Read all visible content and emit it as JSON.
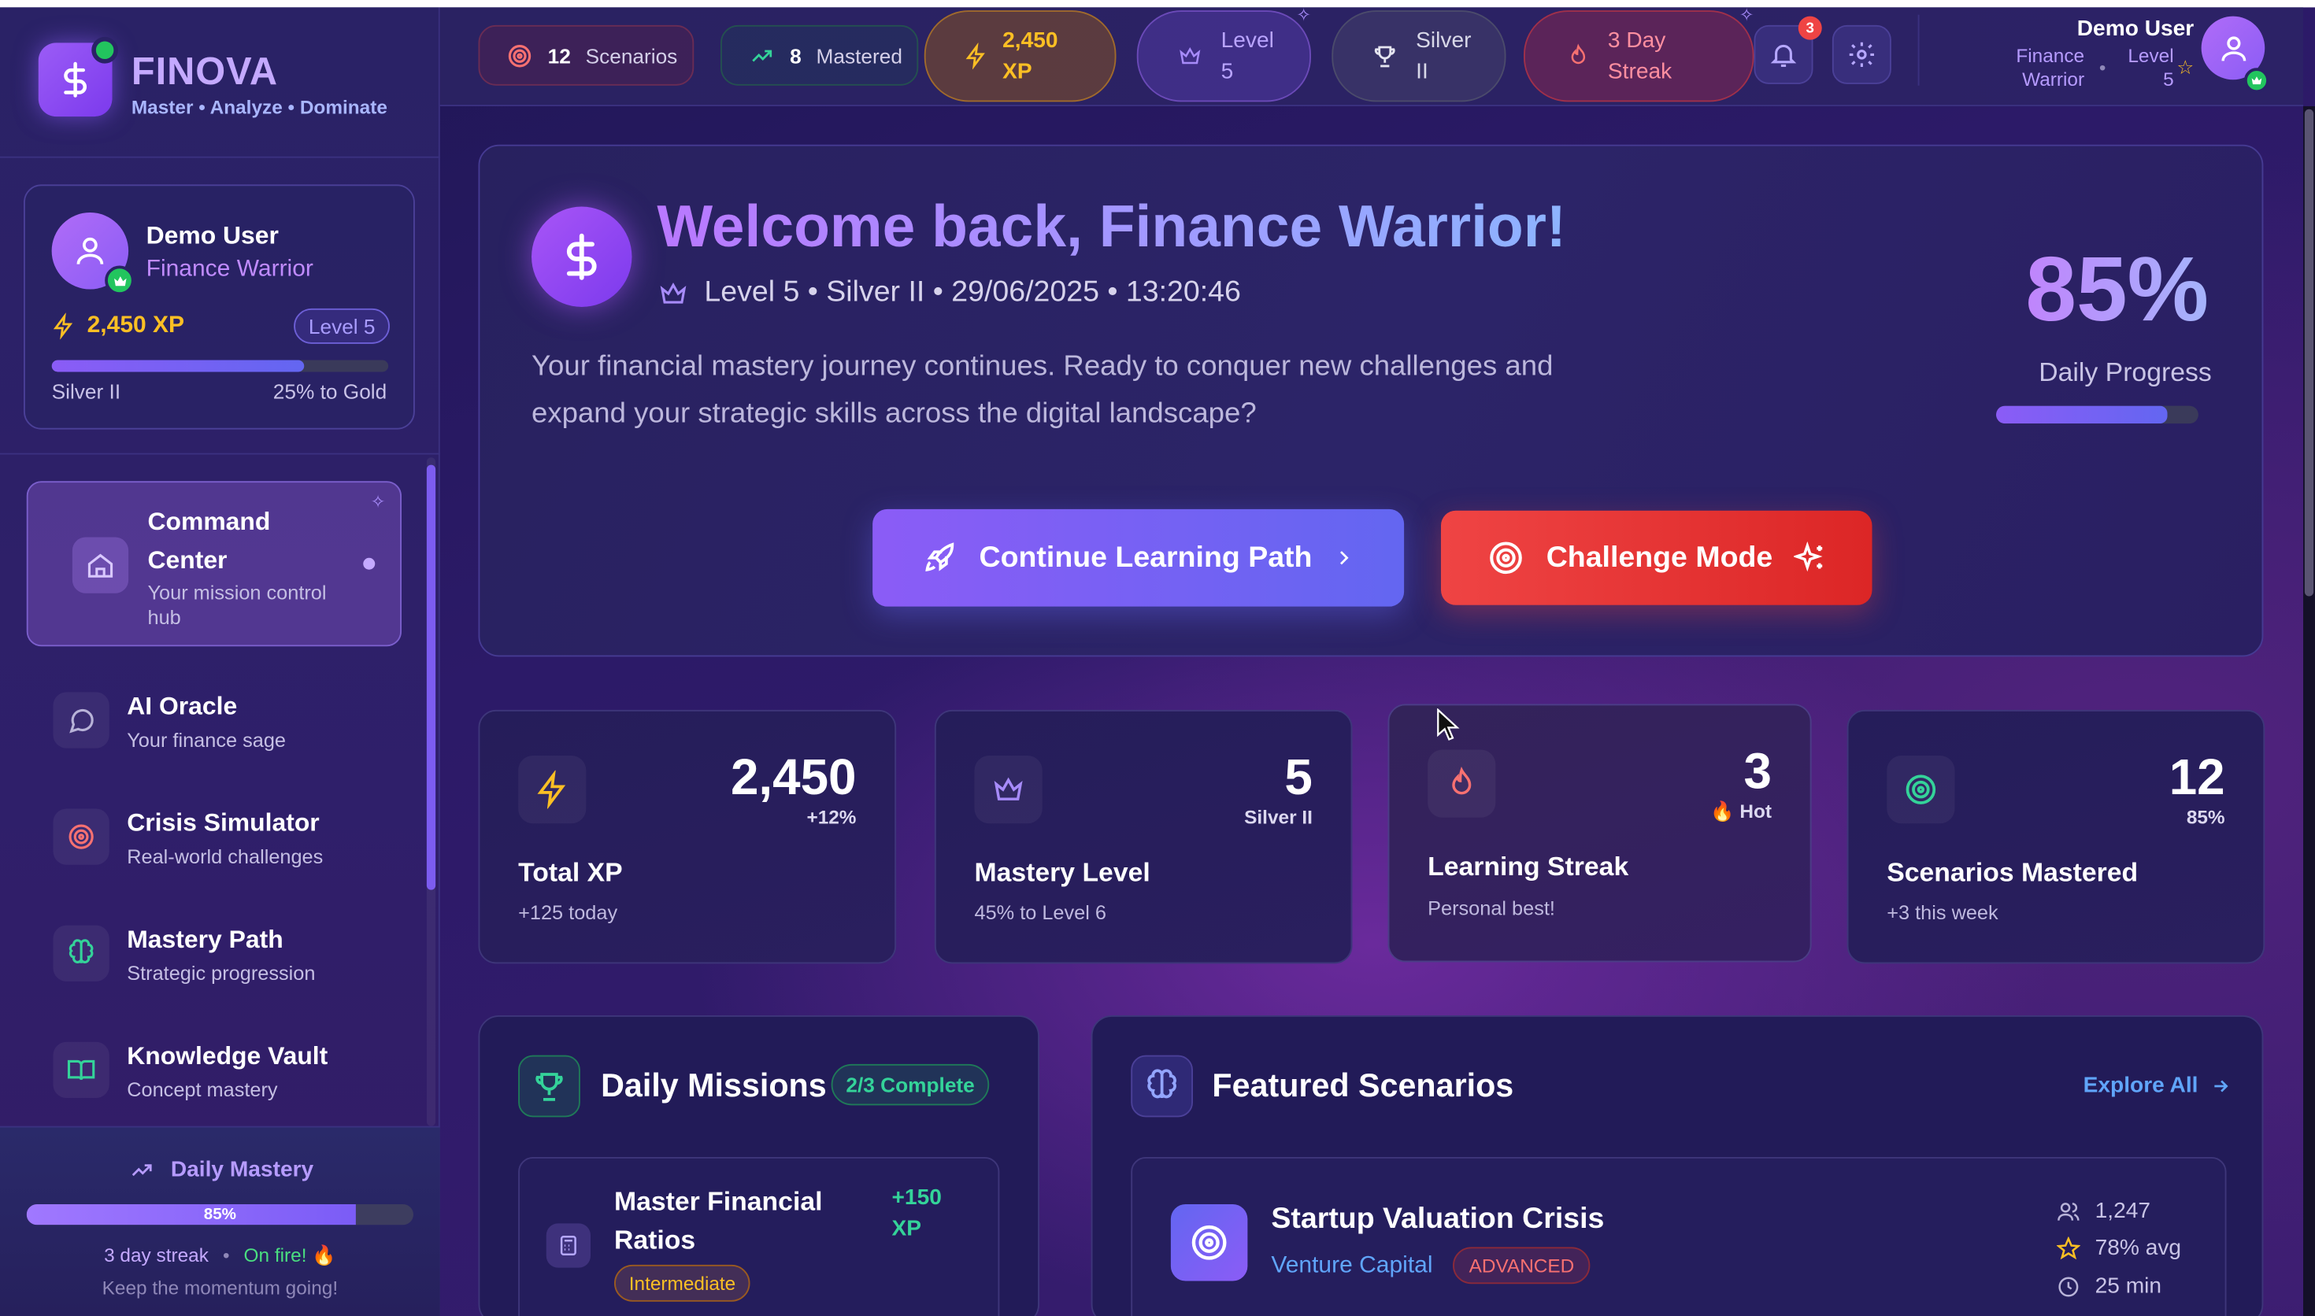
{
  "brand": {
    "name": "FINOVA",
    "tagline": "Master • Analyze • Dominate"
  },
  "user_card": {
    "name": "Demo User",
    "title": "Finance Warrior",
    "xp": "2,450 XP",
    "level": "Level 5",
    "progress": 0.75,
    "rank": "Silver II",
    "next": "25% to Gold"
  },
  "nav": [
    {
      "title": "Command Center",
      "subtitle": "Your mission control hub",
      "icon": "home-icon",
      "active": true
    },
    {
      "title": "AI Oracle",
      "subtitle": "Your finance sage",
      "icon": "chat-icon"
    },
    {
      "title": "Crisis Simulator",
      "subtitle": "Real-world challenges",
      "icon": "target-icon"
    },
    {
      "title": "Mastery Path",
      "subtitle": "Strategic progression",
      "icon": "brain-icon"
    },
    {
      "title": "Knowledge Vault",
      "subtitle": "Concept mastery",
      "icon": "book-icon"
    }
  ],
  "daily_mastery": {
    "title": "Daily Mastery",
    "percent": "85%",
    "progress": 0.85,
    "streak": "3 day streak",
    "status": "On fire! 🔥",
    "note": "Keep the momentum going!"
  },
  "topbar": {
    "scenarios": {
      "count": "12",
      "label": "Scenarios"
    },
    "mastered": {
      "count": "8",
      "label": "Mastered"
    },
    "xp": "2,450 XP",
    "level": "Level 5",
    "rank": "Silver II",
    "streak": "3 Day Streak",
    "notifications": "3",
    "user": {
      "name": "Demo User",
      "title": "Finance Warrior",
      "level": "Level 5"
    }
  },
  "welcome": {
    "title": "Welcome back, Finance Warrior!",
    "meta": "Level 5 • Silver II • 29/06/2025 • 13:20:46",
    "text": "Your financial mastery journey continues. Ready to conquer new challenges and expand your strategic skills across the digital landscape?",
    "progress_percent": "85%",
    "progress_label": "Daily Progress",
    "progress": 0.85,
    "continue_label": "Continue Learning Path",
    "challenge_label": "Challenge Mode"
  },
  "stats": [
    {
      "value": "2,450",
      "badge": "+12%",
      "title": "Total XP",
      "sub": "+125 today",
      "icon": "bolt-icon",
      "color": "#fbbf24"
    },
    {
      "value": "5",
      "badge": "Silver II",
      "title": "Mastery Level",
      "sub": "45% to Level 6",
      "icon": "crown-icon",
      "color": "#a78bfa"
    },
    {
      "value": "3",
      "badge": "🔥 Hot",
      "title": "Learning Streak",
      "sub": "Personal best!",
      "icon": "flame-icon",
      "color": "#f87171"
    },
    {
      "value": "12",
      "badge": "85%",
      "title": "Scenarios Mastered",
      "sub": "+3 this week",
      "icon": "target-icon",
      "color": "#34d399"
    }
  ],
  "missions": {
    "title": "Daily Missions",
    "status": "2/3 Complete",
    "items": [
      {
        "title": "Master Financial Ratios",
        "xp": "+150 XP",
        "difficulty": "Intermediate"
      }
    ]
  },
  "featured": {
    "title": "Featured Scenarios",
    "explore": "Explore All",
    "items": [
      {
        "title": "Startup Valuation Crisis",
        "category": "Venture Capital",
        "difficulty": "ADVANCED",
        "players": "1,247",
        "avg": "78% avg",
        "time": "25 min"
      }
    ]
  },
  "colors": {
    "accent": "#8b5cf6",
    "danger": "#ef4444",
    "success": "#22c55e",
    "gold": "#fbbf24"
  }
}
